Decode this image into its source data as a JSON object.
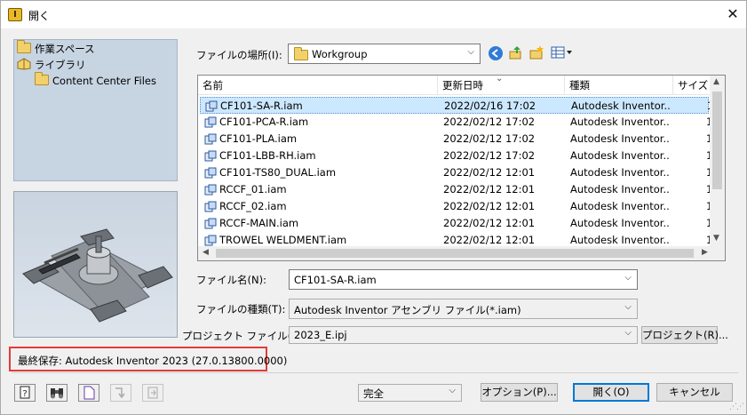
{
  "window": {
    "title": "開く",
    "app_icon_glyph": "I"
  },
  "places": [
    {
      "label": "作業スペース",
      "icon": "folder-icon"
    },
    {
      "label": "ライブラリ",
      "icon": "library-icon"
    },
    {
      "label": "Content Center Files",
      "icon": "folder-icon"
    }
  ],
  "location": {
    "label": "ファイルの場所(I):",
    "value": "Workgroup"
  },
  "file_list": {
    "columns": [
      "名前",
      "更新日時",
      "種類",
      "サイズ"
    ],
    "rows": [
      {
        "name": "CF101-SA-R.iam",
        "date": "2022/02/16 17:02",
        "type": "Autodesk Inventor...",
        "size": "1",
        "selected": true
      },
      {
        "name": "CF101-PCA-R.iam",
        "date": "2022/02/12 17:02",
        "type": "Autodesk Inventor...",
        "size": "1"
      },
      {
        "name": "CF101-PLA.iam",
        "date": "2022/02/12 17:02",
        "type": "Autodesk Inventor...",
        "size": "1"
      },
      {
        "name": "CF101-LBB-RH.iam",
        "date": "2022/02/12 17:02",
        "type": "Autodesk Inventor...",
        "size": "1"
      },
      {
        "name": "CF101-TS80_DUAL.iam",
        "date": "2022/02/12 12:01",
        "type": "Autodesk Inventor...",
        "size": "1"
      },
      {
        "name": "RCCF_01.iam",
        "date": "2022/02/12 12:01",
        "type": "Autodesk Inventor...",
        "size": "1"
      },
      {
        "name": "RCCF_02.iam",
        "date": "2022/02/12 12:01",
        "type": "Autodesk Inventor...",
        "size": "1"
      },
      {
        "name": "RCCF-MAIN.iam",
        "date": "2022/02/12 12:01",
        "type": "Autodesk Inventor...",
        "size": "1"
      },
      {
        "name": "TROWEL WELDMENT.iam",
        "date": "2022/02/12 12:01",
        "type": "Autodesk Inventor...",
        "size": "1"
      }
    ]
  },
  "filename": {
    "label": "ファイル名(N):",
    "value": "CF101-SA-R.iam"
  },
  "filetype": {
    "label": "ファイルの種類(T):",
    "value": "Autodesk Inventor アセンブリ ファイル(*.iam)"
  },
  "project": {
    "label": "プロジェクト ファイル(J):",
    "value": "2023_E.ipj",
    "button": "プロジェクト(R)..."
  },
  "last_saved": "最終保存: Autodesk Inventor 2023 (27.0.13800.0000)",
  "footer": {
    "mode": "完全",
    "options_button": "オプション(P)...",
    "open_button": "開く(O)",
    "cancel_button": "キャンセル"
  },
  "colors": {
    "selection": "#cce8ff",
    "highlight_box": "#e23b3b",
    "default_button": "#0078d7"
  }
}
